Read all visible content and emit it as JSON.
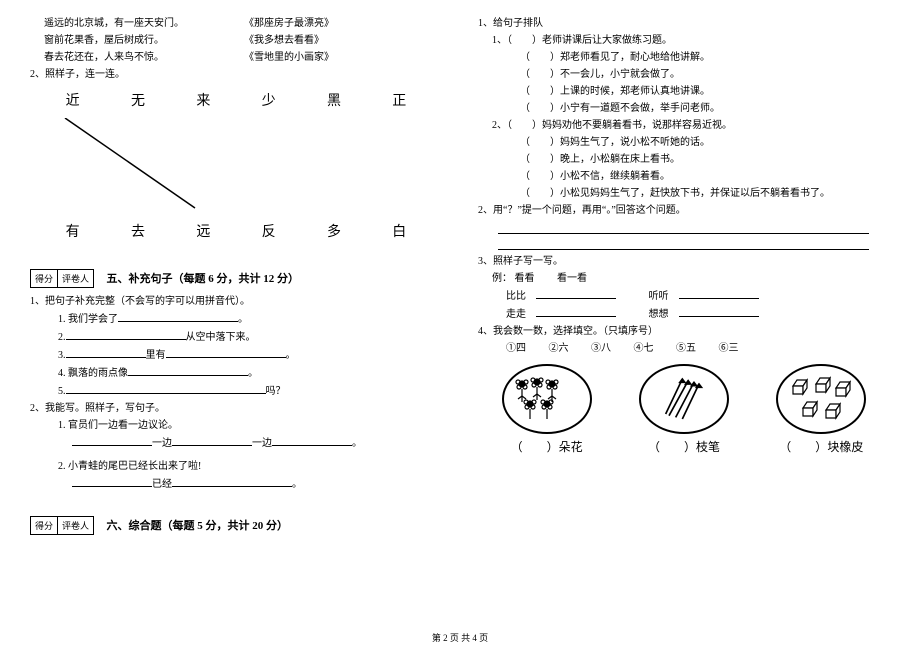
{
  "left": {
    "match_lines": [
      {
        "l": "遥远的北京城，有一座天安门。",
        "r": "《那座房子最漂亮》"
      },
      {
        "l": "窗前花果香，屋后树成行。",
        "r": "《我多想去看看》"
      },
      {
        "l": "春去花还在，人来鸟不惊。",
        "r": "《雪地里的小画家》"
      }
    ],
    "q2_title": "2、照样子，连一连。",
    "top_chars": [
      "近",
      "无",
      "来",
      "少",
      "黑",
      "正"
    ],
    "bot_chars": [
      "有",
      "去",
      "远",
      "反",
      "多",
      "白"
    ],
    "score_labels": {
      "a": "得分",
      "b": "评卷人"
    },
    "sec5": "五、补充句子（每题 6 分，共计 12 分）",
    "q5_1": "1、把句子补充完整（不会写的字可以用拼音代）。",
    "fills": [
      "1. 我们学会了",
      "2.",
      "3.",
      "4. 飘落的雨点像",
      "5."
    ],
    "fill2_suffix": "从空中落下来。",
    "fill3_mid": "里有",
    "fill5_suffix": "吗？",
    "q5_2": "2、我能写。照样子，写句子。",
    "ex1": "1. 官员们一边看一边议论。",
    "ex1_mid": "一边",
    "ex1_mid2": "一边",
    "ex2": "2. 小青蛙的尾巴已经长出来了啦!",
    "ex2_word": "已经",
    "sec6": "六、综合题（每题 5 分，共计 20 分）"
  },
  "right": {
    "q1": "1、给句子排队",
    "g1": [
      "老师讲课后让大家做练习题。",
      "郑老师看见了，耐心地给他讲解。",
      "不一会儿，小宁就会做了。",
      "上课的时候，郑老师认真地讲课。",
      "小宁有一道题不会做，举手问老师。"
    ],
    "g2": [
      "妈妈劝他不要躺着看书，说那样容易近视。",
      "妈妈生气了，说小松不听她的话。",
      "晚上，小松躺在床上看书。",
      "小松不信，继续躺着看。",
      "小松见妈妈生气了，赶快放下书，并保证以后不躺着看书了。"
    ],
    "q2": "2、用“？”提一个问题，再用“。”回答这个问题。",
    "q3": "3、照样子写一写。",
    "ex_label": "例：",
    "ex_words": {
      "a": "看看",
      "b": "看一看"
    },
    "pairs": [
      [
        "比比",
        "听听"
      ],
      [
        "走走",
        "想想"
      ]
    ],
    "q4": "4、我会数一数，选择填空。（只填序号）",
    "opts": [
      "①四",
      "②六",
      "③八",
      "④七",
      "⑤五",
      "⑥三"
    ],
    "captions": [
      "朵花",
      "枝笔",
      "块橡皮"
    ]
  },
  "footer": "第 2 页 共 4 页"
}
